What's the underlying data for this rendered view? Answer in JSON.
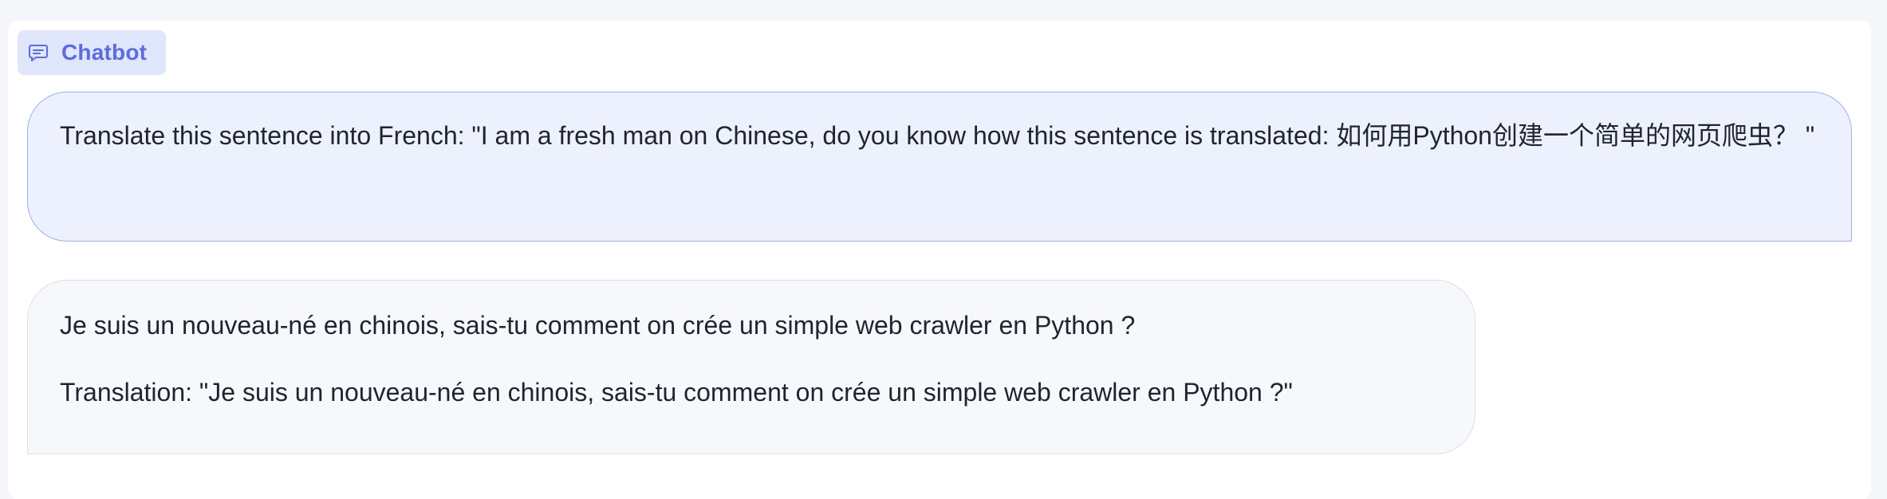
{
  "chatbot": {
    "label": "Chatbot",
    "icon": "chat-bubble-icon",
    "accent_color": "#5b6ddb"
  },
  "messages": [
    {
      "role": "user",
      "text": "Translate this sentence into French: \"I am a fresh man on Chinese, do you know how this sentence is translated: 如何用Python创建一个简单的网页爬虫？ \""
    },
    {
      "role": "bot",
      "paragraphs": [
        "Je suis un nouveau-né en chinois, sais-tu comment on crée un simple web crawler en Python ?",
        "Translation: \"Je suis un nouveau-né en chinois, sais-tu comment on crée un simple web crawler en Python ?\""
      ]
    }
  ]
}
